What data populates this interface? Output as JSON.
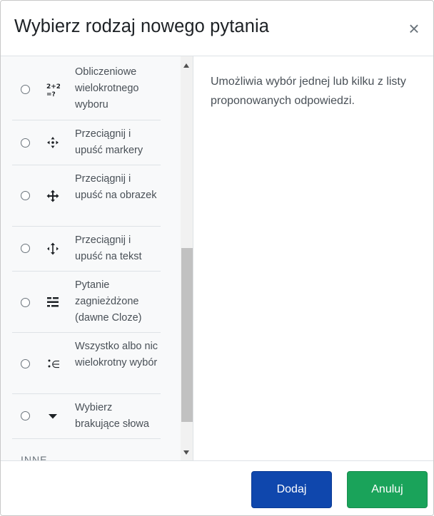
{
  "dialog": {
    "title": "Wybierz rodzaj nowego pytania",
    "close_symbol": "×"
  },
  "question_types": [
    {
      "label": "Obliczeniowe wielokrotnego wyboru",
      "icon": "calculated-multichoice-icon",
      "selected": false
    },
    {
      "label": "Przeciągnij i upuść markery",
      "icon": "drag-drop-markers-icon",
      "selected": false
    },
    {
      "label": "Przeciągnij i upuść na obrazek",
      "icon": "drag-drop-image-icon",
      "selected": false
    },
    {
      "label": "Przeciągnij i upuść na tekst",
      "icon": "drag-drop-text-icon",
      "selected": false
    },
    {
      "label": "Pytanie zagnieżdżone (dawne Cloze)",
      "icon": "embedded-answers-icon",
      "selected": false
    },
    {
      "label": "Wszystko albo nic wielokrotny wybór",
      "icon": "all-or-nothing-icon",
      "selected": false
    },
    {
      "label": "Wybierz brakujące słowa",
      "icon": "select-missing-words-icon",
      "selected": false
    }
  ],
  "section_other_label": "INNE",
  "description": "Umożliwia wybór jednej lub kilku z listy proponowanych odpowiedzi.",
  "footer": {
    "add_label": "Dodaj",
    "cancel_label": "Anuluj"
  },
  "colors": {
    "primary": "#0f47ad",
    "success": "#1aa35a"
  }
}
